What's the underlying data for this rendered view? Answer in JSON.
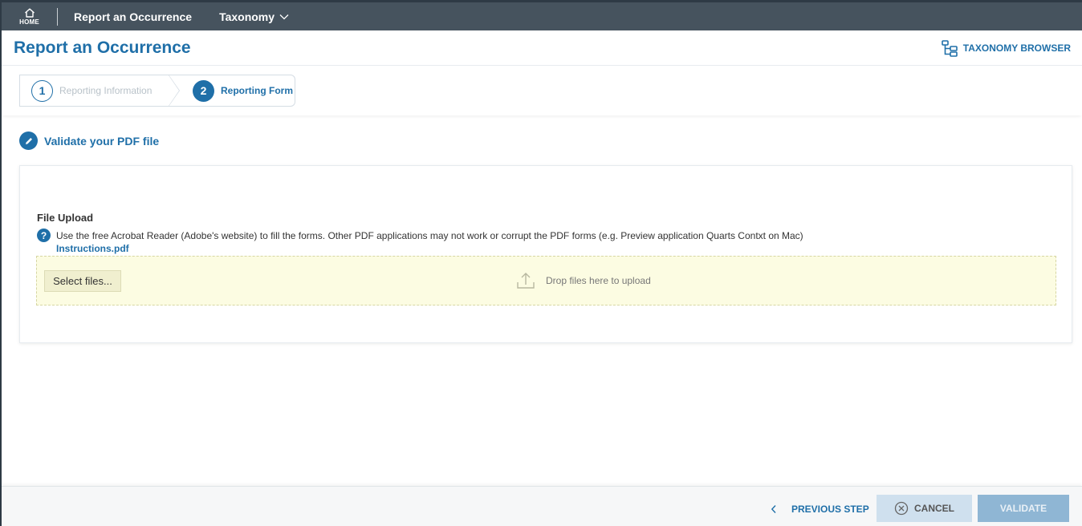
{
  "topnav": {
    "home_label": "HOME",
    "items": [
      {
        "label": "Report an Occurrence"
      },
      {
        "label": "Taxonomy"
      }
    ]
  },
  "header": {
    "title": "Report an Occurrence",
    "taxonomy_browser": "TAXONOMY BROWSER"
  },
  "stepper": {
    "steps": [
      {
        "number": "1",
        "label": "Reporting Information"
      },
      {
        "number": "2",
        "label": "Reporting Form"
      }
    ]
  },
  "section": {
    "title": "Validate your PDF file"
  },
  "upload": {
    "label": "File Upload",
    "help_text": "Use the free Acrobat Reader (Adobe's website) to fill the forms. Other PDF applications may not work or corrupt the PDF forms (e.g. Preview application Quarts Contxt on Mac)",
    "help_icon": "?",
    "instructions_link": "Instructions.pdf",
    "select_button": "Select files...",
    "drop_text": "Drop files here to upload"
  },
  "footer": {
    "previous": "PREVIOUS STEP",
    "cancel": "CANCEL",
    "validate": "VALIDATE"
  },
  "colors": {
    "primary": "#1f6fa8",
    "nav_bg": "#46535e",
    "dropzone_bg": "#fcfce2"
  }
}
